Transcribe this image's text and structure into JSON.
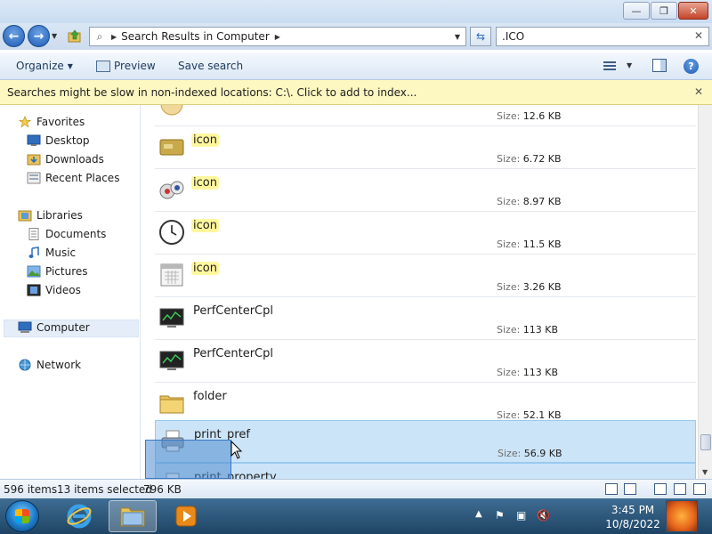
{
  "window": {
    "minimize_glyph": "—",
    "maximize_glyph": "❐",
    "close_glyph": "✕"
  },
  "address": {
    "breadcrumb": "Search Results in Computer",
    "search_value": ".ICO"
  },
  "toolbar": {
    "organize": "Organize",
    "preview": "Preview",
    "save_search": "Save search"
  },
  "infobar": {
    "message": "Searches might be slow in non-indexed locations: C:\\. Click to add to index..."
  },
  "nav": {
    "favorites": "Favorites",
    "desktop": "Desktop",
    "downloads": "Downloads",
    "recent_places": "Recent Places",
    "libraries": "Libraries",
    "documents": "Documents",
    "music": "Music",
    "pictures": "Pictures",
    "videos": "Videos",
    "computer": "Computer",
    "network": "Network"
  },
  "files": {
    "size_label": "Size:",
    "items": [
      {
        "name": "",
        "size": "12.6 KB",
        "icon": "generic-icon",
        "highlight": false,
        "selected": false
      },
      {
        "name": "icon",
        "size": "6.72 KB",
        "icon": "card-icon",
        "highlight": true,
        "selected": false
      },
      {
        "name": "icon",
        "size": "8.97 KB",
        "icon": "users-icon",
        "highlight": true,
        "selected": false
      },
      {
        "name": "icon",
        "size": "11.5 KB",
        "icon": "clock-icon",
        "highlight": true,
        "selected": false
      },
      {
        "name": "icon",
        "size": "3.26 KB",
        "icon": "calendar-icon",
        "highlight": true,
        "selected": false
      },
      {
        "name": "PerfCenterCpl",
        "size": "113 KB",
        "icon": "monitor-icon",
        "highlight": false,
        "selected": false
      },
      {
        "name": "PerfCenterCpl",
        "size": "113 KB",
        "icon": "monitor-icon",
        "highlight": false,
        "selected": false
      },
      {
        "name": "folder",
        "size": "52.1 KB",
        "icon": "folder-icon",
        "highlight": false,
        "selected": false
      },
      {
        "name": "print_pref",
        "size": "56.9 KB",
        "icon": "printer-icon",
        "highlight": false,
        "selected": true
      },
      {
        "name": "print_property",
        "size": "",
        "icon": "printer-icon",
        "highlight": false,
        "selected": true
      }
    ]
  },
  "status": {
    "item_count": "596 items",
    "selected": "13 items selected",
    "selected_size": "796 KB"
  },
  "clock": {
    "time": "3:45 PM",
    "date": "10/8/2022"
  }
}
